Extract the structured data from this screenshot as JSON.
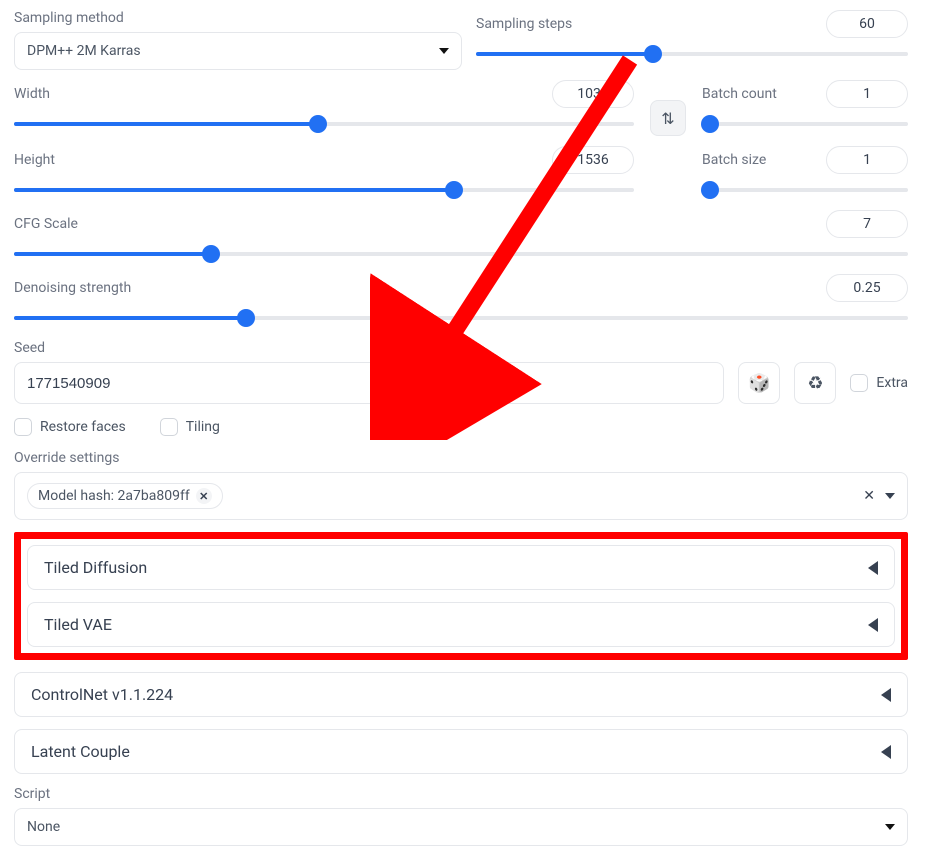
{
  "sampling": {
    "method_label": "Sampling method",
    "method_value": "DPM++ 2M Karras",
    "steps_label": "Sampling steps",
    "steps_value": "60",
    "steps_fill_pct": 41
  },
  "width": {
    "label": "Width",
    "value": "1032",
    "fill_pct": 49
  },
  "height": {
    "label": "Height",
    "value": "1536",
    "fill_pct": 71
  },
  "batch_count": {
    "label": "Batch count",
    "value": "1",
    "fill_pct": 4
  },
  "batch_size": {
    "label": "Batch size",
    "value": "1",
    "fill_pct": 4
  },
  "cfg": {
    "label": "CFG Scale",
    "value": "7",
    "fill_pct": 22
  },
  "denoise": {
    "label": "Denoising strength",
    "value": "0.25",
    "fill_pct": 26
  },
  "seed": {
    "label": "Seed",
    "value": "1771540909",
    "extra_label": "Extra"
  },
  "restore_faces_label": "Restore faces",
  "tiling_label": "Tiling",
  "override": {
    "label": "Override settings",
    "tag": "Model hash: 2a7ba809ff"
  },
  "accordions": {
    "tiled_diffusion": "Tiled Diffusion",
    "tiled_vae": "Tiled VAE",
    "controlnet": "ControlNet v1.1.224",
    "latent_couple": "Latent Couple"
  },
  "script": {
    "label": "Script",
    "value": "None"
  },
  "icons": {
    "swap": "⇅",
    "dice": "🎲",
    "recycle": "♻"
  }
}
